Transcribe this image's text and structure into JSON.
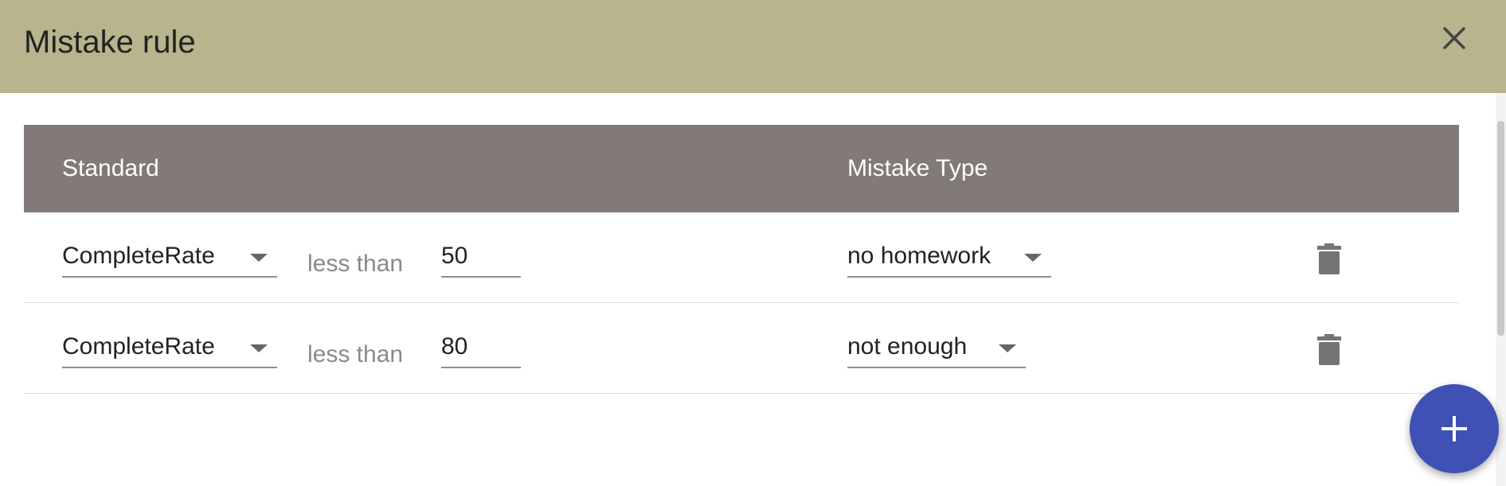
{
  "dialog": {
    "title": "Mistake rule",
    "close_icon": "close-icon"
  },
  "table": {
    "headers": {
      "standard": "Standard",
      "mistake_type": "Mistake Type"
    },
    "rows": [
      {
        "standard": "CompleteRate",
        "operator": "less than",
        "value": "50",
        "mistake_type": "no homework",
        "delete_icon": "trash-icon"
      },
      {
        "standard": "CompleteRate",
        "operator": "less than",
        "value": "80",
        "mistake_type": "not enough",
        "delete_icon": "trash-icon"
      }
    ]
  },
  "fab": {
    "icon": "plus-icon"
  },
  "colors": {
    "title_bar": "#b7b48e",
    "table_header": "#817a78",
    "fab": "#3f51b5"
  }
}
